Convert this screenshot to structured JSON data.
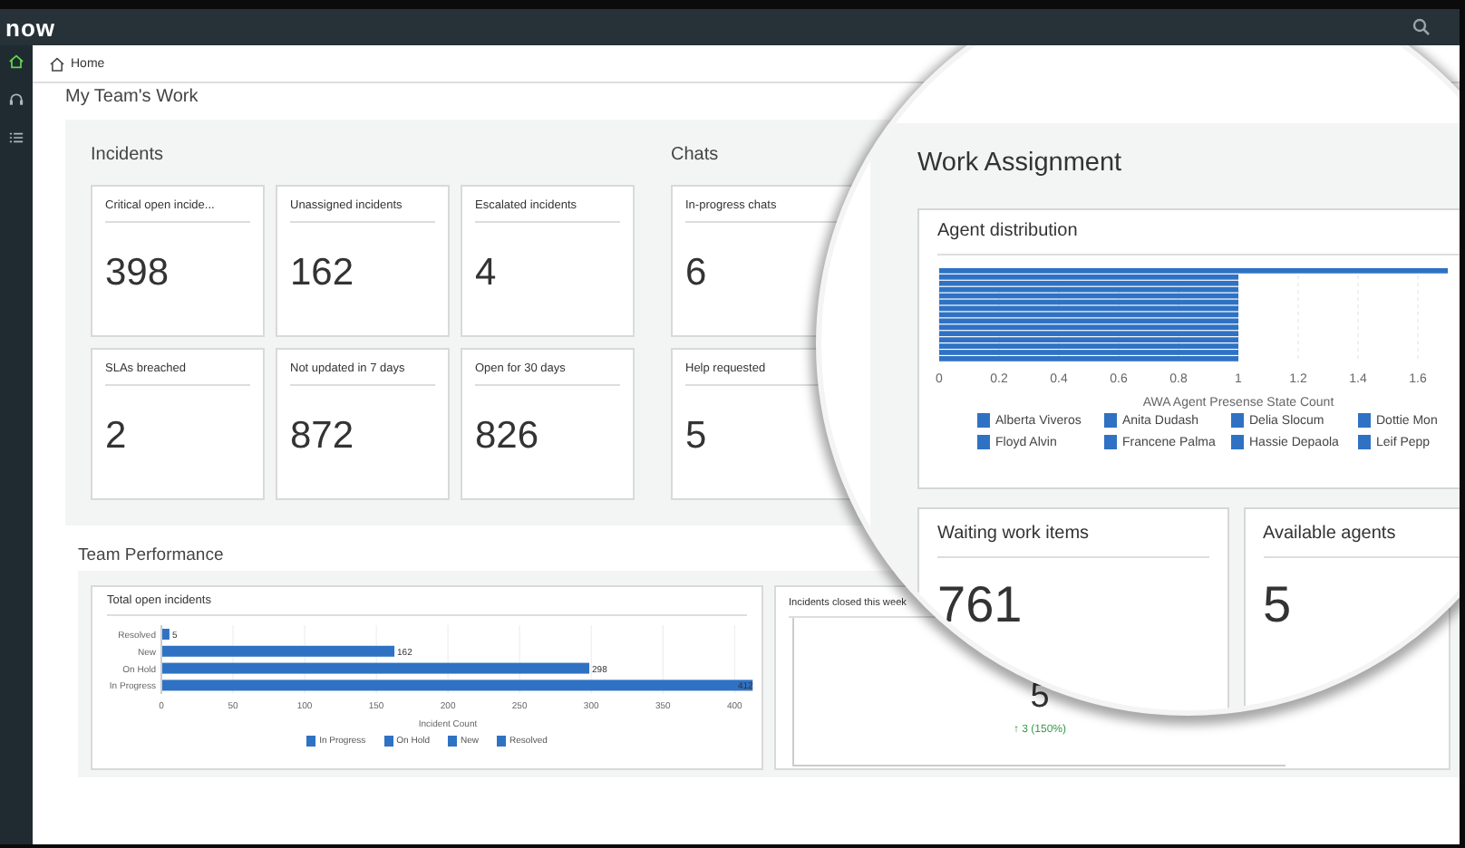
{
  "topbar": {
    "logo": "now"
  },
  "sidebar": {
    "items": [
      {
        "kind": "home",
        "selected": true
      },
      {
        "kind": "headset",
        "selected": false
      },
      {
        "kind": "list",
        "selected": false
      }
    ]
  },
  "breadcrumb": {
    "label": "Home"
  },
  "page_title": "My Team's Work",
  "incidents": {
    "title": "Incidents",
    "cards": [
      {
        "label": "Critical open incide...",
        "value": "398"
      },
      {
        "label": "Unassigned incidents",
        "value": "162"
      },
      {
        "label": "Escalated incidents",
        "value": "4"
      },
      {
        "label": "SLAs breached",
        "value": "2"
      },
      {
        "label": "Not updated in 7 days",
        "value": "872"
      },
      {
        "label": "Open for 30 days",
        "value": "826"
      }
    ]
  },
  "chats": {
    "title": "Chats",
    "cards": [
      {
        "label": "In-progress chats",
        "value": "6"
      },
      {
        "label": "Help requested",
        "value": "5"
      }
    ]
  },
  "team_performance": {
    "title": "Team Performance",
    "total_open_incidents": {
      "title": "Total open incidents",
      "legend": [
        "In Progress",
        "On Hold",
        "New",
        "Resolved"
      ],
      "chart_data": {
        "type": "bar",
        "orientation": "horizontal",
        "xlabel": "Incident Count",
        "categories": [
          "Resolved",
          "New",
          "On Hold",
          "In Progress"
        ],
        "values": [
          5,
          162,
          298,
          412
        ],
        "xlim": [
          0,
          415
        ],
        "xticks": [
          0,
          50,
          100,
          150,
          200,
          250,
          300,
          350,
          400
        ],
        "grid": true,
        "data_labels": true
      }
    },
    "incidents_closed": {
      "title": "Incidents closed this week",
      "value": "5",
      "change": "↑ 3 (150%)"
    }
  },
  "work_assignment": {
    "title": "Work Assignment",
    "agent_distribution": {
      "title": "Agent distribution",
      "legend": [
        "Alberta Viveros",
        "Anita Dudash",
        "Delia Slocum",
        "Dottie Mon",
        "Floyd Alvin",
        "Francene Palma",
        "Hassie Depaola",
        "Leif Pepp"
      ],
      "chart_data": {
        "type": "bar",
        "orientation": "horizontal",
        "xlabel": "AWA Agent Presense State Count",
        "values": [
          1.7,
          1,
          1,
          1,
          1,
          1,
          1,
          1,
          1,
          1,
          1,
          1,
          1,
          1,
          1
        ],
        "xlim": [
          0,
          1.7
        ],
        "xticks": [
          0,
          0.2,
          0.4,
          0.6,
          0.8,
          1,
          1.2,
          1.4,
          1.6
        ],
        "grid": true
      }
    },
    "cards": [
      {
        "label": "Waiting work items",
        "value": "761"
      },
      {
        "label": "Available agents",
        "value": "5"
      }
    ]
  }
}
